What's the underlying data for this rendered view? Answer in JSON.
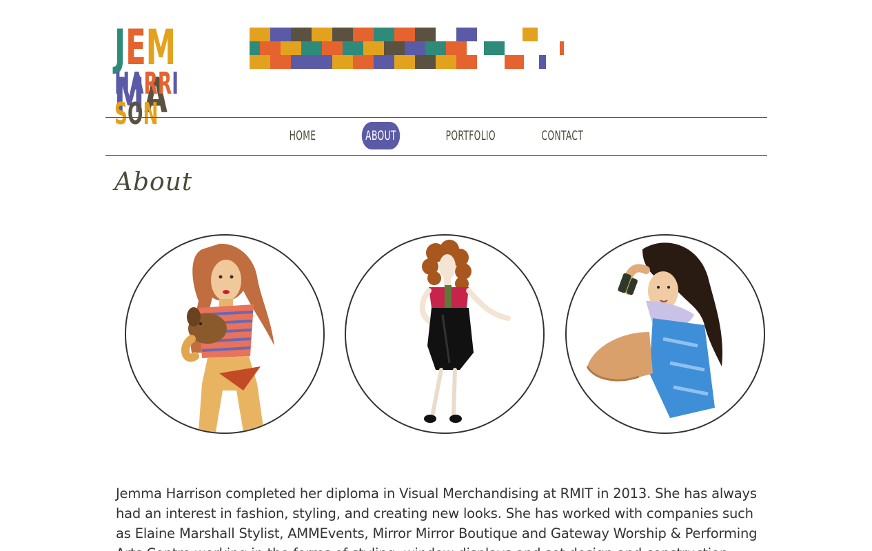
{
  "brand": {
    "line1": "JEMMA",
    "line2": "HARRISON",
    "line1_colors": [
      "#2e8b7a",
      "#e5632f",
      "#e3a21e",
      "#5b5aa6",
      "#5b5140"
    ],
    "line2_colors": [
      "#5b5aa6",
      "#5b5aa6",
      "#e5632f",
      "#e5632f",
      "#5b5aa6",
      "#e3a21e",
      "#5b5140",
      "#e3a21e"
    ]
  },
  "palette": {
    "teal": "#2e8b7a",
    "orange": "#e5632f",
    "mustard": "#e3a21e",
    "purple": "#5b5aa6",
    "brown": "#5b5140"
  },
  "nav": {
    "items": [
      {
        "label": "HOME"
      },
      {
        "label": "ABOUT",
        "active": true
      },
      {
        "label": "PORTFOLIO"
      },
      {
        "label": "CONTACT"
      }
    ],
    "active_color": "#5b5aa6"
  },
  "main": {
    "title": "About",
    "portraits": [
      {
        "name": "portrait-redhead-with-puppy"
      },
      {
        "name": "portrait-curly-hair-black-skirt"
      },
      {
        "name": "portrait-seated-blue-dress"
      }
    ],
    "bio_lines": [
      "Jemma Harrison completed her diploma in Visual Merchandising at RMIT in 2013. She has always",
      "had an interest in fashion, styling, and creating new looks. She has worked with companies  such",
      "as Elaine Marshall Stylist, AMMEvents, Mirror Mirror Boutique and Gateway Worship & Performing",
      "Arts Centre working in the forms of styling, window displays and set design and construction."
    ]
  }
}
